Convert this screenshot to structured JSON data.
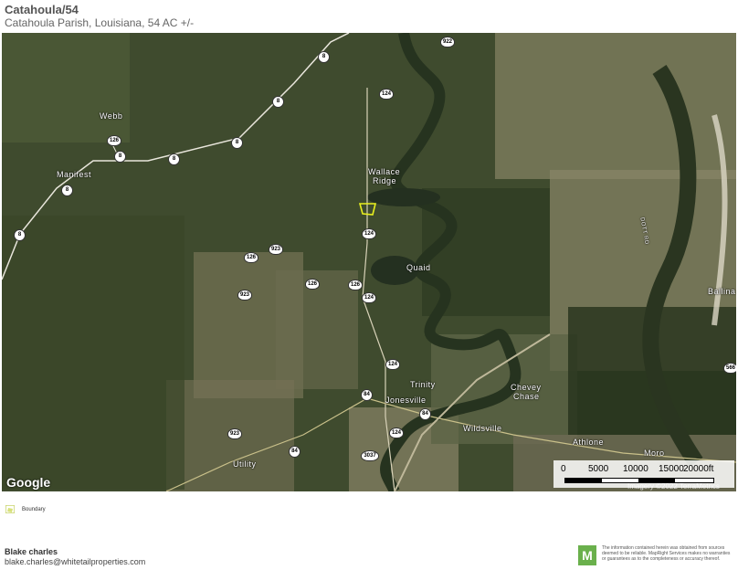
{
  "header": {
    "title": "Catahoula/54",
    "subtitle": "Catahoula Parish, Louisiana, 54 AC +/-"
  },
  "map": {
    "place_labels": {
      "webb": "Webb",
      "manifest": "Manifest",
      "wallace": "Wallace",
      "ridge": "Ridge",
      "quaid": "Quaid",
      "trinity": "Trinity",
      "jonesville": "Jonesville",
      "chevey": "Chevey",
      "chase": "Chase",
      "wildsville": "Wildsville",
      "athlone": "Athlone",
      "moro": "Moro",
      "utility": "Utility",
      "ballina": "Ballina",
      "dott_rd": "DOTT RD"
    },
    "road_shields": {
      "r922": "922",
      "r8a": "8",
      "r8b": "8",
      "r8c": "8",
      "r8d": "8",
      "r8e": "8",
      "r8f": "8",
      "r8g": "8",
      "r124a": "124",
      "r124b": "124",
      "r124c": "124",
      "r124d": "124",
      "r124e": "124",
      "r126a": "126",
      "r126b": "126",
      "r126c": "126",
      "r126d": "126",
      "r923a": "923",
      "r923b": "923",
      "r923c": "923",
      "r84a": "84",
      "r84b": "84",
      "r84c": "84",
      "r3037": "3037",
      "r566": "566"
    },
    "attribution": "Google",
    "imagery_credit": "Imagery ©2022 TerraMetrics",
    "boundary_color": "#e8ef1e",
    "water_color": "#2f3d2a"
  },
  "scale": {
    "labels": [
      "0",
      "5000",
      "10000",
      "15000",
      "20000ft"
    ]
  },
  "legend": {
    "items": [
      {
        "label": "Boundary",
        "color": "#d7e17a"
      }
    ]
  },
  "footer": {
    "agent_name": "Blake charles",
    "agent_email": "blake.charles@whitetailproperties.com",
    "logo_letter": "M",
    "disclaimer": "The information contained herein was obtained from sources deemed to be reliable. MapRight Services makes no warranties or guarantees as to the completeness or accuracy thereof."
  }
}
